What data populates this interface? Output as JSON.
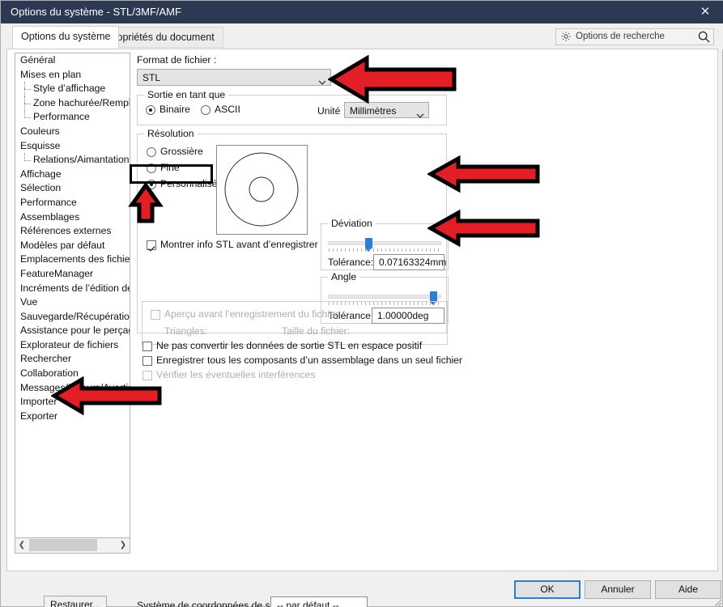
{
  "window": {
    "title": "Options du système - STL/3MF/AMF",
    "close_icon": "close-icon"
  },
  "tabs": [
    {
      "label": "Options du système",
      "active": true
    },
    {
      "label": "Propriétés du document",
      "active": false
    }
  ],
  "search": {
    "placeholder": "Options de recherche",
    "gear_icon": "gear-icon",
    "magnifier_icon": "search-icon"
  },
  "sidebar": {
    "items": [
      {
        "label": "Général",
        "child": false
      },
      {
        "label": "Mises en plan",
        "child": false
      },
      {
        "label": "Style d’affichage",
        "child": true
      },
      {
        "label": "Zone hachurée/Remplir",
        "child": true
      },
      {
        "label": "Performance",
        "child": true
      },
      {
        "label": "Couleurs",
        "child": false
      },
      {
        "label": "Esquisse",
        "child": false
      },
      {
        "label": "Relations/Aimantation",
        "child": true
      },
      {
        "label": "Affichage",
        "child": false
      },
      {
        "label": "Sélection",
        "child": false
      },
      {
        "label": "Performance",
        "child": false
      },
      {
        "label": "Assemblages",
        "child": false
      },
      {
        "label": "Références externes",
        "child": false
      },
      {
        "label": "Modèles par défaut",
        "child": false
      },
      {
        "label": "Emplacements des fichiers",
        "child": false
      },
      {
        "label": "FeatureManager",
        "child": false
      },
      {
        "label": "Incréments de l’édition de c",
        "child": false
      },
      {
        "label": "Vue",
        "child": false
      },
      {
        "label": "Sauvegarde/Récupération",
        "child": false
      },
      {
        "label": "Assistance pour le perçage/",
        "child": false
      },
      {
        "label": "Explorateur de fichiers",
        "child": false
      },
      {
        "label": "Rechercher",
        "child": false
      },
      {
        "label": "Collaboration",
        "child": false
      },
      {
        "label": "Messages/Erreurs/Avertisse",
        "child": false
      },
      {
        "label": "Importer",
        "child": false
      },
      {
        "label": "Exporter",
        "child": false,
        "selected": true
      }
    ],
    "scroll_left_icon": "chevron-left-icon",
    "scroll_right_icon": "chevron-right-icon",
    "restore_button": "Restaurer..."
  },
  "main": {
    "file_format_label": "Format de fichier :",
    "file_format_value": "STL",
    "output_group_title": "Sortie en tant que",
    "radio_binary": "Binaire",
    "radio_ascii": "ASCII",
    "unit_label": "Unité",
    "unit_value": "Millimètres",
    "resolution_group_title": "Résolution",
    "radio_coarse": "Grossière",
    "radio_fine": "Fine",
    "radio_custom": "Personnalisée",
    "show_stl_info": "Montrer info STL avant d’enregistrer",
    "deviation_group_title": "Déviation",
    "deviation_tolerance_label": "Tolérance:",
    "deviation_tolerance_value": "0.07163324mm",
    "deviation_slider_percent": 36,
    "angle_group_title": "Angle",
    "angle_tolerance_label": "Tolérance",
    "angle_tolerance_value": "1.00000deg",
    "angle_slider_percent": 92,
    "preview_checkbox": "Aperçu avant l’enregistrement du fichier",
    "triangles_label": "Triangles:",
    "filesize_label": "Taille du fichier:",
    "no_convert_checkbox": "Ne pas convertir les données de sortie STL en espace positif",
    "save_all_checkbox": "Enregistrer tous les composants d’un assemblage dans un seul fichier",
    "check_interference_checkbox": "Vérifier les éventuelles interférences",
    "coord_system_label": "Système de coordonnées de sortie:",
    "coord_system_value": "-- par défaut --"
  },
  "footer": {
    "ok": "OK",
    "cancel": "Annuler",
    "help": "Aide"
  },
  "colors": {
    "titlebar": "#2b3a52",
    "accent": "#2a7fd4",
    "annotation_red": "#e31e24",
    "annotation_outline": "#000000"
  },
  "annotations": [
    {
      "name": "arrow-to-file-format",
      "direction": "left"
    },
    {
      "name": "arrow-to-deviation-tolerance",
      "direction": "left"
    },
    {
      "name": "arrow-to-angle-tolerance",
      "direction": "left"
    },
    {
      "name": "arrow-to-custom-radio",
      "direction": "up"
    },
    {
      "name": "arrow-to-exporter-item",
      "direction": "left"
    },
    {
      "name": "highlight-box-custom-radio",
      "shape": "rectangle"
    }
  ]
}
